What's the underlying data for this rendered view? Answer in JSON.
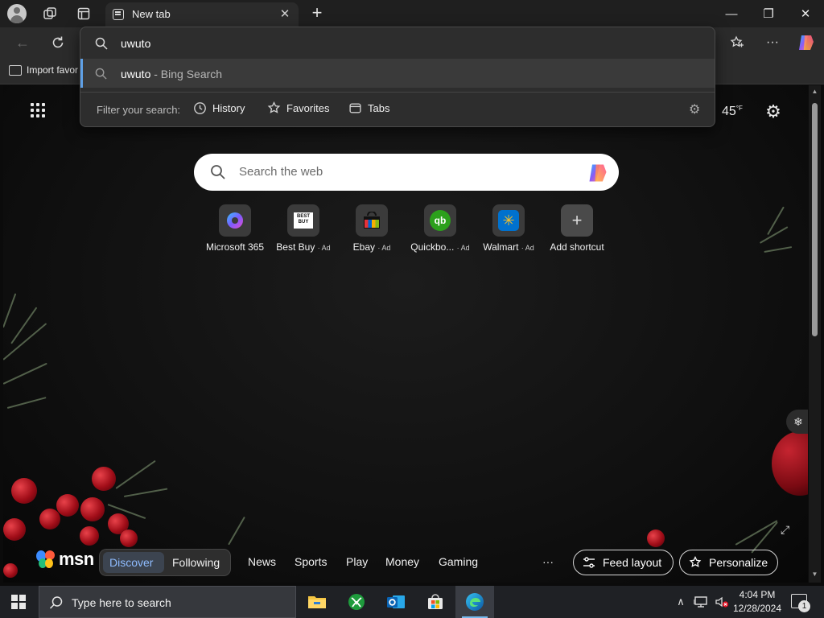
{
  "tab": {
    "title": "New tab",
    "close": "✕"
  },
  "window": {
    "minimize": "—",
    "maximize": "❐",
    "close": "✕"
  },
  "favorites_bar": {
    "import_label": "Import favor"
  },
  "address_dropdown": {
    "input_value": "uwuto",
    "suggestion_query": "uwuto",
    "suggestion_source": " - Bing Search",
    "filter_label": "Filter your search:",
    "filters": [
      "History",
      "Favorites",
      "Tabs"
    ]
  },
  "new_tab_page": {
    "weather": "45",
    "weather_unit": "°F",
    "search_placeholder": "Search the web",
    "shortcuts": [
      {
        "label": "Microsoft 365",
        "ad": ""
      },
      {
        "label": "Best Buy",
        "ad": "· Ad"
      },
      {
        "label": "Ebay",
        "ad": "· Ad"
      },
      {
        "label": "Quickbo...",
        "ad": "· Ad"
      },
      {
        "label": "Walmart",
        "ad": "· Ad"
      },
      {
        "label": "Add shortcut",
        "ad": ""
      }
    ],
    "bestbuy_tile_text": "BEST BUY",
    "qb_tile_text": "qb"
  },
  "msn": {
    "logo": "msn",
    "tabs": [
      "Discover",
      "Following"
    ],
    "links": [
      "News",
      "Sports",
      "Play",
      "Money",
      "Gaming"
    ],
    "more": "···",
    "feed_layout": "Feed layout",
    "personalize": "Personalize"
  },
  "taskbar": {
    "search_placeholder": "Type here to search",
    "time": "4:04 PM",
    "date": "12/28/2024",
    "notification_count": "1"
  },
  "colors": {
    "accent": "#5fa0e6",
    "page_background": "#0b0b0b",
    "berry": "#b8141f"
  }
}
